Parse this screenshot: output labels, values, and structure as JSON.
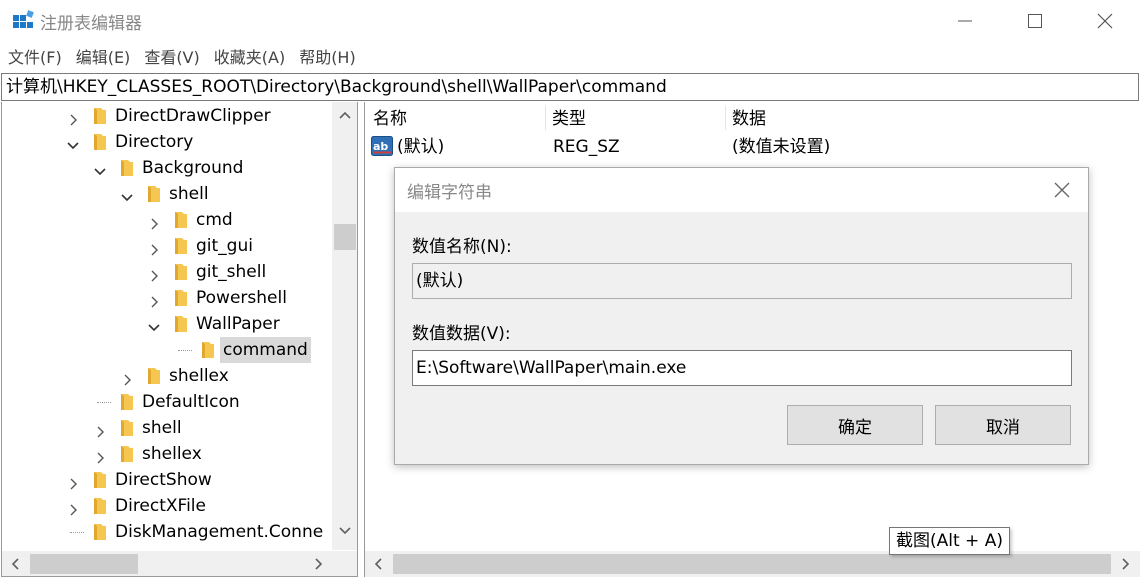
{
  "window": {
    "title": "注册表编辑器",
    "icon": "regedit-icon"
  },
  "menu": [
    "文件(F)",
    "编辑(E)",
    "查看(V)",
    "收藏夹(A)",
    "帮助(H)"
  ],
  "address": "计算机\\HKEY_CLASSES_ROOT\\Directory\\Background\\shell\\WallPaper\\command",
  "tree": {
    "items": [
      {
        "label": "DirectDrawClipper",
        "state": "collapsed"
      },
      {
        "label": "Directory",
        "state": "expanded"
      },
      {
        "label": "Background",
        "state": "expanded"
      },
      {
        "label": "shell",
        "state": "expanded"
      },
      {
        "label": "cmd",
        "state": "collapsed"
      },
      {
        "label": "git_gui",
        "state": "collapsed"
      },
      {
        "label": "git_shell",
        "state": "collapsed"
      },
      {
        "label": "Powershell",
        "state": "collapsed"
      },
      {
        "label": "WallPaper",
        "state": "expanded"
      },
      {
        "label": "command",
        "state": "leaf",
        "selected": true
      },
      {
        "label": "shellex",
        "state": "collapsed"
      },
      {
        "label": "DefaultIcon",
        "state": "leaf"
      },
      {
        "label": "shell",
        "state": "collapsed"
      },
      {
        "label": "shellex",
        "state": "collapsed"
      },
      {
        "label": "DirectShow",
        "state": "collapsed"
      },
      {
        "label": "DirectXFile",
        "state": "collapsed"
      },
      {
        "label": "DiskManagement.Conne",
        "state": "leaf"
      }
    ]
  },
  "list": {
    "headers": {
      "name": "名称",
      "type": "类型",
      "data": "数据"
    },
    "rows": [
      {
        "name": "(默认)",
        "type": "REG_SZ",
        "data": "(数值未设置)",
        "icon": "ab-string-icon"
      }
    ]
  },
  "dialog": {
    "title": "编辑字符串",
    "name_label": "数值名称(N):",
    "name_value": "(默认)",
    "data_label": "数值数据(V):",
    "data_value": "E:\\Software\\WallPaper\\main.exe",
    "ok_label": "确定",
    "cancel_label": "取消"
  },
  "tooltip": "截图(Alt + A)",
  "colors": {
    "folder": "#f5c750",
    "folder_dark": "#e0a82e",
    "regedit_blue": "#1e78c8",
    "selection": "#d9d9d9"
  }
}
